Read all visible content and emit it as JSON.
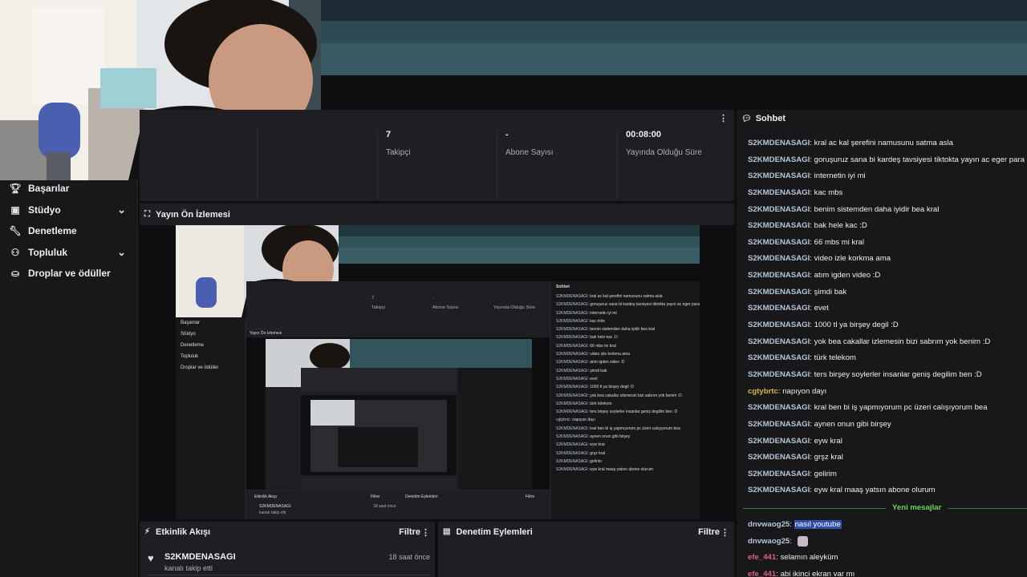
{
  "sidebar": {
    "items": [
      {
        "label": "Başarılar",
        "icon": "trophy-icon",
        "expandable": false
      },
      {
        "label": "Stüdyo",
        "icon": "studio-icon",
        "expandable": true
      },
      {
        "label": "Denetleme",
        "icon": "wrench-icon",
        "expandable": false
      },
      {
        "label": "Topluluk",
        "icon": "community-icon",
        "expandable": true
      },
      {
        "label": "Droplar ve ödüller",
        "icon": "drops-icon",
        "expandable": false
      }
    ]
  },
  "stats": [
    {
      "value": "7",
      "label": "Takipçi"
    },
    {
      "value": "-",
      "label": "Abone Sayısı"
    },
    {
      "value": "00:08:00",
      "label": "Yayında Olduğu Süre"
    }
  ],
  "preview": {
    "title": "Yayın Ön İzlemesi"
  },
  "activity": {
    "title": "Etkinlik Akışı",
    "filter": "Filtre",
    "items": [
      {
        "user": "S2KMDENASAGI",
        "desc": "kanalı takip etti",
        "time": "18 saat önce"
      }
    ]
  },
  "moderation": {
    "title": "Denetim Eylemleri",
    "filter": "Filtre"
  },
  "chat": {
    "title": "Sohbet",
    "new_messages_label": "Yeni mesajlar",
    "messages": [
      {
        "user": "S2KMDENASAGI",
        "color": "#b6c6d9",
        "text": "kral ac kal şerefini namusunu satma asla"
      },
      {
        "user": "S2KMDENASAGI",
        "color": "#b6c6d9",
        "text": "goruşuruz sana bi kardeş tavsiyesi tiktokta yayın ac eger para kaza"
      },
      {
        "user": "S2KMDENASAGI",
        "color": "#b6c6d9",
        "text": "internetin iyi mi"
      },
      {
        "user": "S2KMDENASAGI",
        "color": "#b6c6d9",
        "text": "kac mbs"
      },
      {
        "user": "S2KMDENASAGI",
        "color": "#b6c6d9",
        "text": "benim sistemden daha iyidir bea kral"
      },
      {
        "user": "S2KMDENASAGI",
        "color": "#b6c6d9",
        "text": "bak hele kac :D"
      },
      {
        "user": "S2KMDENASAGI",
        "color": "#b6c6d9",
        "text": "66 mbs mi kral"
      },
      {
        "user": "S2KMDENASAGI",
        "color": "#b6c6d9",
        "text": "video izle korkma ama"
      },
      {
        "user": "S2KMDENASAGI",
        "color": "#b6c6d9",
        "text": "atım igden video :D"
      },
      {
        "user": "S2KMDENASAGI",
        "color": "#b6c6d9",
        "text": "şimdi bak"
      },
      {
        "user": "S2KMDENASAGI",
        "color": "#b6c6d9",
        "text": "evet"
      },
      {
        "user": "S2KMDENASAGI",
        "color": "#b6c6d9",
        "text": "1000 tl ya birşey degil :D"
      },
      {
        "user": "S2KMDENASAGI",
        "color": "#b6c6d9",
        "text": "yok bea cakallar izlemesin bizi sabrım yok benim :D"
      },
      {
        "user": "S2KMDENASAGI",
        "color": "#b6c6d9",
        "text": "türk telekom"
      },
      {
        "user": "S2KMDENASAGI",
        "color": "#b6c6d9",
        "text": "ters birşey soylerler insanlar geniş degilim ben :D"
      },
      {
        "user": "cgtybrtc",
        "color": "#d9b64a",
        "text": "napıyon dayı"
      },
      {
        "user": "S2KMDENASAGI",
        "color": "#b6c6d9",
        "text": "kral ben bi iş yapmıyorum pc üzeri calışıyorum bea"
      },
      {
        "user": "S2KMDENASAGI",
        "color": "#b6c6d9",
        "text": "aynen onun gibi birşey"
      },
      {
        "user": "S2KMDENASAGI",
        "color": "#b6c6d9",
        "text": "eyw kral"
      },
      {
        "user": "S2KMDENASAGI",
        "color": "#b6c6d9",
        "text": "grşz kral"
      },
      {
        "user": "S2KMDENASAGI",
        "color": "#b6c6d9",
        "text": "gelirim"
      },
      {
        "user": "S2KMDENASAGI",
        "color": "#b6c6d9",
        "text": "eyw kral maaş yatsın abone olurum"
      }
    ],
    "new_messages": [
      {
        "user": "dnvwaog25",
        "color": "#b6c6d9",
        "text": "nasıl youtube",
        "highlight": true
      },
      {
        "user": "dnvwaog25",
        "color": "#b6c6d9",
        "text": "",
        "emote": true
      },
      {
        "user": "efe_441",
        "color": "#e0607e",
        "text": "selamın aleyküm"
      },
      {
        "user": "efe_441",
        "color": "#e0607e",
        "text": "abi ikinci ekran var mı"
      }
    ]
  },
  "mini": {
    "chat_title": "Sohbet",
    "preview_title": "Yayın Ön İzlemesi",
    "activity_title": "Etkinlik Akışı",
    "moderation_title": "Denetim Eylemleri",
    "filter": "Filtre"
  },
  "colors": {
    "accent_new_messages": "#6fd35a",
    "highlight": "#2f4fa8"
  }
}
